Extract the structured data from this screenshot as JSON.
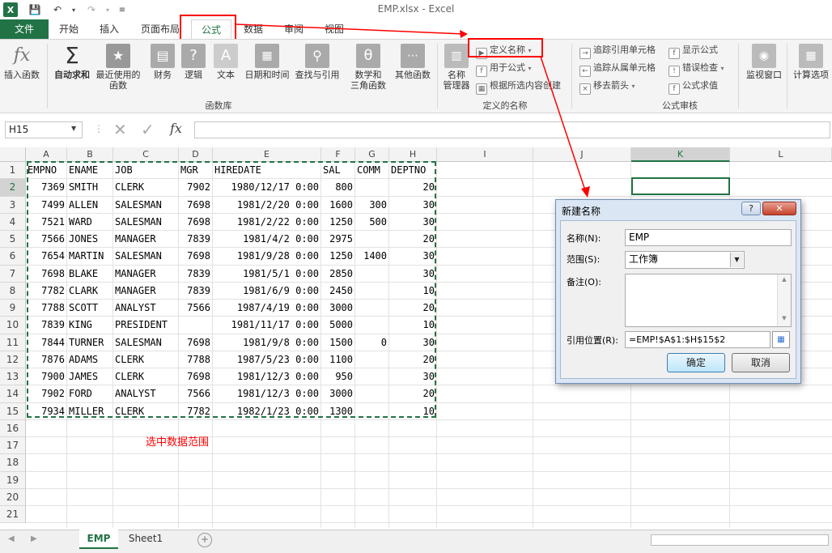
{
  "window": {
    "title": "EMP.xlsx - Excel"
  },
  "tabs": {
    "file": "文件",
    "home": "开始",
    "insert": "插入",
    "layout": "页面布局",
    "formulas": "公式",
    "data": "数据",
    "review": "审阅",
    "view": "视图"
  },
  "ribbon": {
    "insert_function": "插入函数",
    "autosum": "自动求和",
    "recent": [
      "最近使用的",
      "函数"
    ],
    "financial": "财务",
    "logical": "逻辑",
    "text": "文本",
    "datetime": "日期和时间",
    "lookup": "查找与引用",
    "math": [
      "数学和",
      "三角函数"
    ],
    "more": "其他函数",
    "group_library": "函数库",
    "name_manager": [
      "名称",
      "管理器"
    ],
    "define_name": "定义名称",
    "use_in_formula": "用于公式",
    "create_from_sel": "根据所选内容创建",
    "group_names": "定义的名称",
    "trace_precedents": "追踪引用单元格",
    "trace_dependents": "追踪从属单元格",
    "remove_arrows": "移去箭头",
    "show_formulas": "显示公式",
    "error_checking": "错误检查",
    "evaluate": "公式求值",
    "group_audit": "公式审核",
    "watch": "监视窗口",
    "calc_options": "计算选项"
  },
  "formula_bar": {
    "name_box": "H15",
    "fx": "fx",
    "content": ""
  },
  "columns": [
    "A",
    "B",
    "C",
    "D",
    "E",
    "F",
    "G",
    "H",
    "I",
    "J",
    "K",
    "L"
  ],
  "rows": [
    "1",
    "2",
    "3",
    "4",
    "5",
    "6",
    "7",
    "8",
    "9",
    "10",
    "11",
    "12",
    "13",
    "14",
    "15",
    "16",
    "17",
    "18",
    "19",
    "20",
    "21"
  ],
  "table": {
    "header": [
      "EMPNO",
      "ENAME",
      "JOB",
      "MGR",
      "HIREDATE",
      "SAL",
      "COMM",
      "DEPTNO"
    ],
    "data": [
      [
        "7369",
        "SMITH",
        "CLERK",
        "7902",
        "1980/12/17 0:00",
        "800",
        "",
        "20"
      ],
      [
        "7499",
        "ALLEN",
        "SALESMAN",
        "7698",
        "1981/2/20 0:00",
        "1600",
        "300",
        "30"
      ],
      [
        "7521",
        "WARD",
        "SALESMAN",
        "7698",
        "1981/2/22 0:00",
        "1250",
        "500",
        "30"
      ],
      [
        "7566",
        "JONES",
        "MANAGER",
        "7839",
        "1981/4/2 0:00",
        "2975",
        "",
        "20"
      ],
      [
        "7654",
        "MARTIN",
        "SALESMAN",
        "7698",
        "1981/9/28 0:00",
        "1250",
        "1400",
        "30"
      ],
      [
        "7698",
        "BLAKE",
        "MANAGER",
        "7839",
        "1981/5/1 0:00",
        "2850",
        "",
        "30"
      ],
      [
        "7782",
        "CLARK",
        "MANAGER",
        "7839",
        "1981/6/9 0:00",
        "2450",
        "",
        "10"
      ],
      [
        "7788",
        "SCOTT",
        "ANALYST",
        "7566",
        "1987/4/19 0:00",
        "3000",
        "",
        "20"
      ],
      [
        "7839",
        "KING",
        "PRESIDENT",
        "",
        "1981/11/17 0:00",
        "5000",
        "",
        "10"
      ],
      [
        "7844",
        "TURNER",
        "SALESMAN",
        "7698",
        "1981/9/8 0:00",
        "1500",
        "0",
        "30"
      ],
      [
        "7876",
        "ADAMS",
        "CLERK",
        "7788",
        "1987/5/23 0:00",
        "1100",
        "",
        "20"
      ],
      [
        "7900",
        "JAMES",
        "CLERK",
        "7698",
        "1981/12/3 0:00",
        "950",
        "",
        "30"
      ],
      [
        "7902",
        "FORD",
        "ANALYST",
        "7566",
        "1981/12/3 0:00",
        "3000",
        "",
        "20"
      ],
      [
        "7934",
        "MILLER",
        "CLERK",
        "7782",
        "1982/1/23 0:00",
        "1300",
        "",
        "10"
      ]
    ]
  },
  "annotation": "选中数据范围",
  "sheets": [
    "EMP",
    "Sheet1"
  ],
  "dialog": {
    "title": "新建名称",
    "help": "?",
    "name_label": "名称(N):",
    "name_value": "EMP",
    "scope_label": "范围(S):",
    "scope_value": "工作簿",
    "comment_label": "备注(O):",
    "ref_label": "引用位置(R):",
    "ref_value": "=EMP!$A$1:$H$15$2",
    "ok": "确定",
    "cancel": "取消"
  },
  "colors": {
    "accent": "#217346",
    "highlight": "#ff0000"
  }
}
